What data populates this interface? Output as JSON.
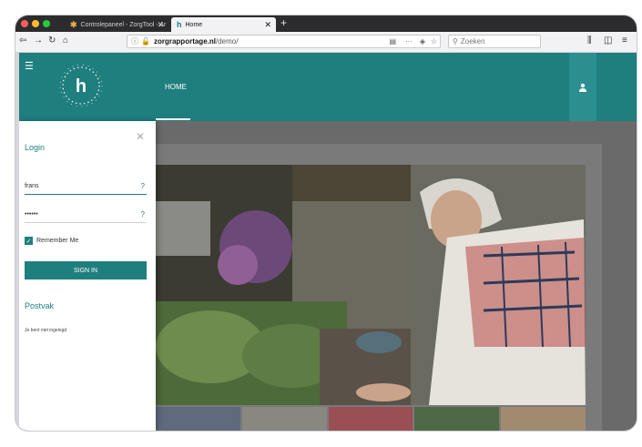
{
  "browser": {
    "tabs": [
      {
        "label": "Controlepaneel - ZorgTool - Ar",
        "favicon": "puzzle-favicon"
      },
      {
        "label": "Home",
        "favicon": "h-favicon"
      }
    ],
    "url": {
      "host": "zorgrapportage.nl",
      "path": "/demo/"
    },
    "search_placeholder": "Zoeken"
  },
  "header": {
    "nav_home": "HOME"
  },
  "login": {
    "title": "Login",
    "username_value": "frans",
    "password_value": "••••••",
    "help_icon": "?",
    "remember_label": "Remember Me",
    "signin_label": "SIGN IN",
    "postvak_title": "Postvak",
    "status_text": "Je bent niet ingelogd"
  },
  "colors": {
    "brand": "#1f7e7e",
    "tabbar": "#2c2c2e"
  }
}
